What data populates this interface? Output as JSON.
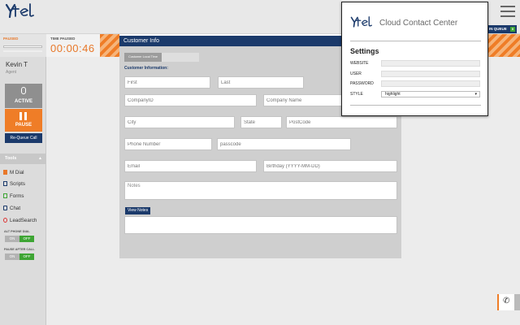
{
  "brand": {
    "name": "Cloud Contact Center",
    "colors": {
      "navy": "#1b3a6b",
      "orange": "#ef7d27",
      "green": "#3ea534"
    }
  },
  "agent": {
    "paused_label": "PAUSED",
    "name": "Kevin T",
    "role": "Agent",
    "active_label": "ACTIVE",
    "pause_label": "PAUSE",
    "requeue_label": "Re-Queue Call"
  },
  "timer": {
    "label": "TIME PAUSED",
    "value": "00:00:46"
  },
  "queue": {
    "label": "IN QUEUE",
    "count": "0"
  },
  "tools": {
    "header": "Tools",
    "items": [
      {
        "label": "M Dial",
        "icon": "phone-book-icon"
      },
      {
        "label": "Scripts",
        "icon": "script-icon"
      },
      {
        "label": "Forms",
        "icon": "forms-icon"
      },
      {
        "label": "Chat",
        "icon": "chat-icon"
      },
      {
        "label": "LeadSearch",
        "icon": "search-icon"
      }
    ]
  },
  "toggles": [
    {
      "label": "ALT PHONE DIAL",
      "on": "ON",
      "off": "OFF"
    },
    {
      "label": "PAUSE AFTER CALL",
      "on": "ON",
      "off": "OFF"
    }
  ],
  "form": {
    "title": "Customer Info",
    "local_time_label": "Customer Local Time",
    "section_label": "Customer Information:",
    "placeholders": {
      "first": "First",
      "last": "Last",
      "company_id": "CompanyID",
      "company_name": "Company Name",
      "city": "City",
      "state": "State",
      "postcode": "PostCode",
      "phone": "Phone Number",
      "passcode": "passcode",
      "email": "Email",
      "birthday": "Birthday (YYYY-MM-DD)",
      "notes": "Notes"
    },
    "view_notes_label": "View Notes"
  },
  "settings_popup": {
    "title": "Settings",
    "rows": [
      {
        "label": "WEBSITE",
        "value": ""
      },
      {
        "label": "USER",
        "value": ""
      },
      {
        "label": "PASSWORD",
        "value": ""
      },
      {
        "label": "STYLE",
        "value": "highlight"
      }
    ]
  }
}
